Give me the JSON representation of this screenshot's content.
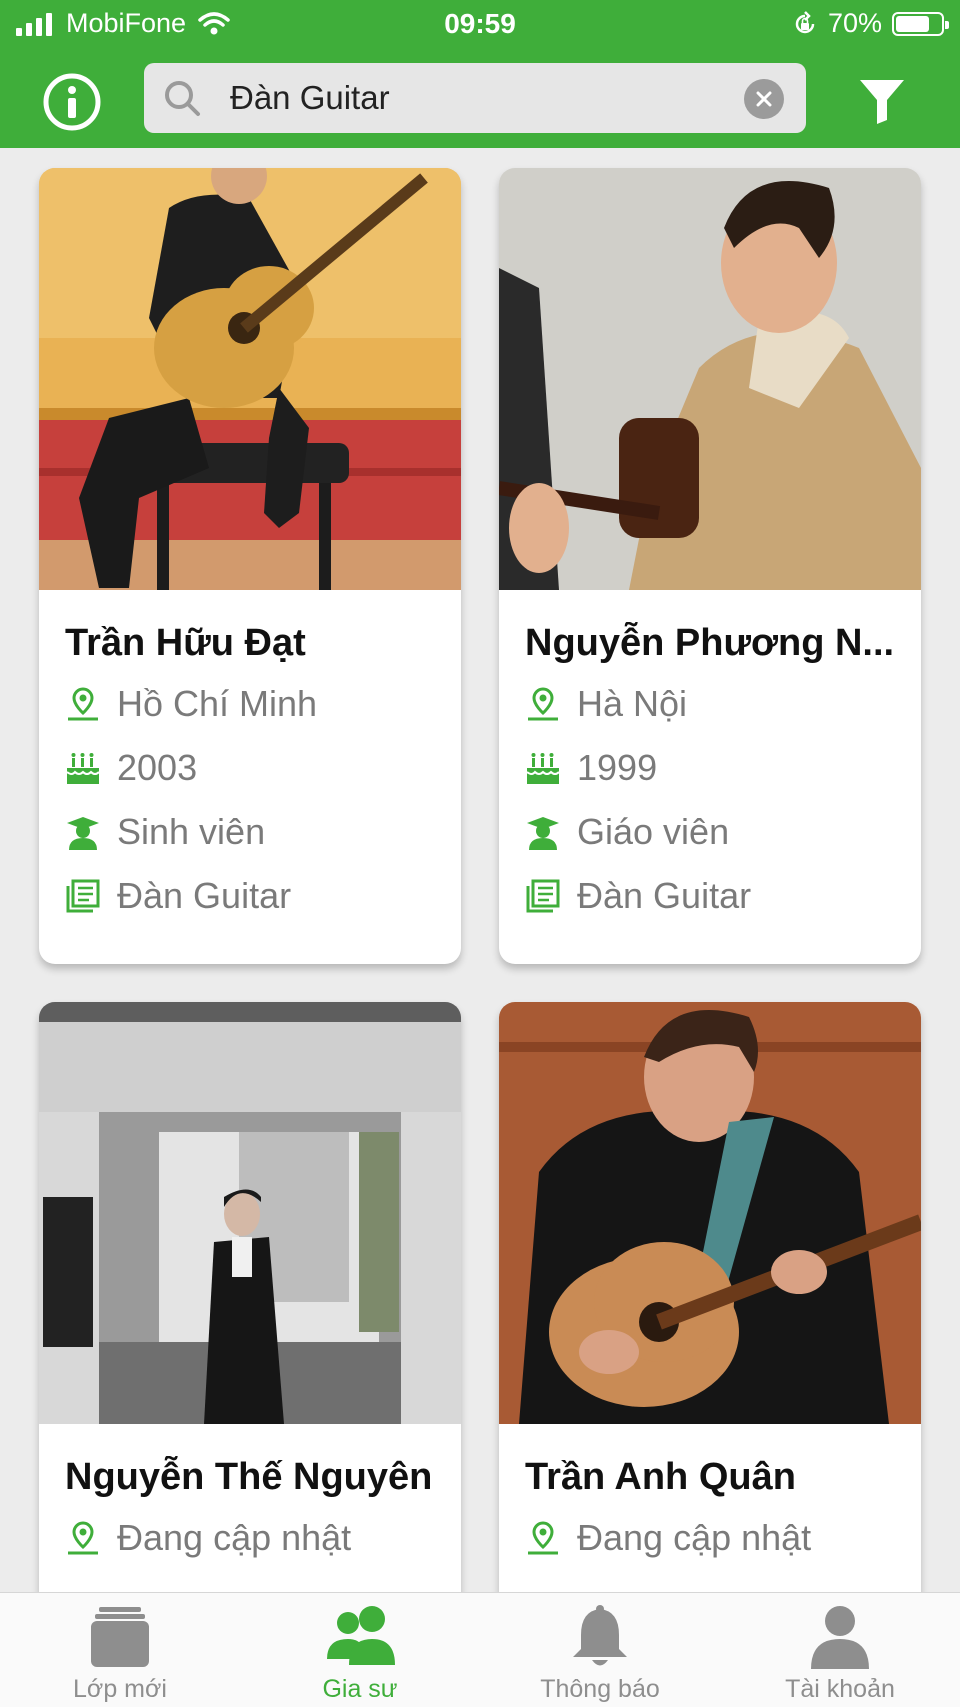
{
  "colors": {
    "brand": "#3fae3a",
    "inactive": "#8e8e8e",
    "text_secondary": "#7a7a7a"
  },
  "status_bar": {
    "carrier": "MobiFone",
    "time": "09:59",
    "battery": "70%"
  },
  "search": {
    "value": "Đàn Guitar",
    "clear_icon": "close-icon"
  },
  "header": {
    "left_icon": "info-icon",
    "right_icon": "filter-icon"
  },
  "tutors": [
    {
      "name": "Trần Hữu Đạt",
      "location": "Hồ Chí Minh",
      "birth_year": "2003",
      "occupation": "Sinh viên",
      "subject": "Đàn Guitar"
    },
    {
      "name": "Nguyễn Phương N...",
      "location": "Hà Nội",
      "birth_year": "1999",
      "occupation": "Giáo viên",
      "subject": "Đàn Guitar"
    },
    {
      "name": "Nguyễn Thế Nguyên",
      "location": "Đang cập nhật"
    },
    {
      "name": "Trần Anh Quân",
      "location": "Đang cập nhật"
    }
  ],
  "tabbar": {
    "items": [
      {
        "label": "Lớp mới",
        "icon": "folder-icon",
        "active": false
      },
      {
        "label": "Gia sư",
        "icon": "users-icon",
        "active": true
      },
      {
        "label": "Thông báo",
        "icon": "bell-icon",
        "active": false
      },
      {
        "label": "Tài khoản",
        "icon": "user-icon",
        "active": false
      }
    ]
  }
}
